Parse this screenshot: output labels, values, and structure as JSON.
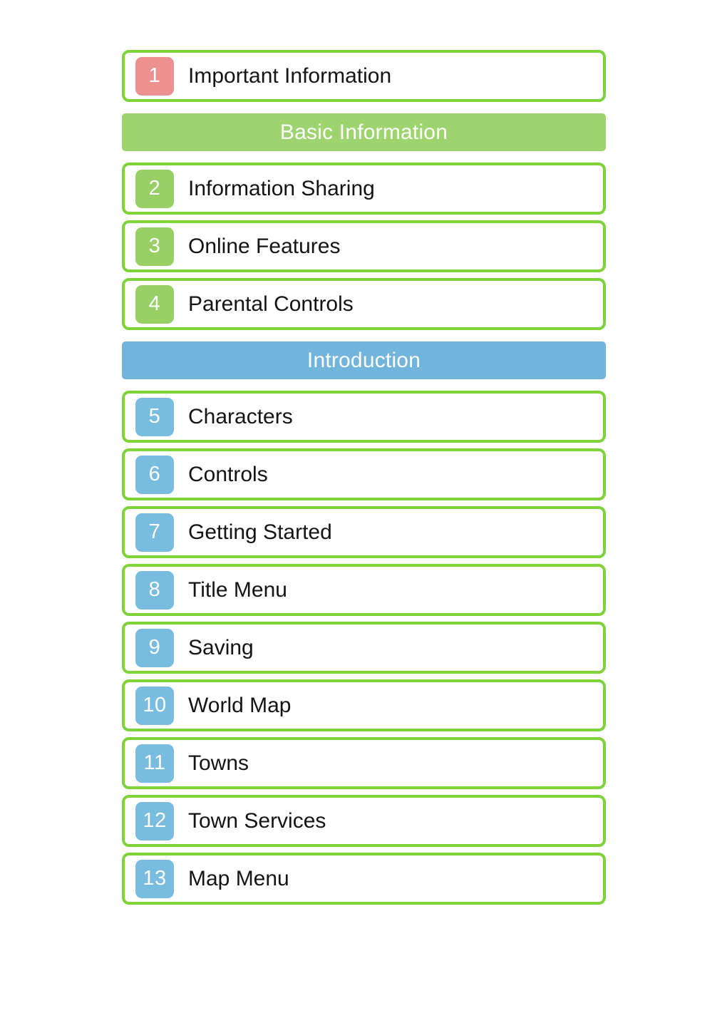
{
  "document": {
    "type": "electronic-manual-table-of-contents",
    "background_color": "#ffffff"
  },
  "colors": {
    "card_border_green": "#7ed338",
    "band_green": "#9ed46e",
    "band_blue": "#72b5dc",
    "badge_red": "#ec9090",
    "badge_green": "#98d065",
    "badge_blue": "#78bcdf",
    "label_text": "#141414",
    "band_text": "#ffffff"
  },
  "toc": {
    "blocks": [
      {
        "kind": "chapters",
        "items": [
          {
            "number": "1",
            "label": "Important Information",
            "badge_color": "red"
          }
        ]
      },
      {
        "kind": "section",
        "title": "Basic Information",
        "band_color": "green"
      },
      {
        "kind": "chapters",
        "items": [
          {
            "number": "2",
            "label": "Information Sharing",
            "badge_color": "green"
          },
          {
            "number": "3",
            "label": "Online Features",
            "badge_color": "green"
          },
          {
            "number": "4",
            "label": "Parental Controls",
            "badge_color": "green"
          }
        ]
      },
      {
        "kind": "section",
        "title": "Introduction",
        "band_color": "blue"
      },
      {
        "kind": "chapters",
        "items": [
          {
            "number": "5",
            "label": "Characters",
            "badge_color": "blue"
          },
          {
            "number": "6",
            "label": "Controls",
            "badge_color": "blue"
          },
          {
            "number": "7",
            "label": "Getting Started",
            "badge_color": "blue"
          },
          {
            "number": "8",
            "label": "Title Menu",
            "badge_color": "blue"
          },
          {
            "number": "9",
            "label": "Saving",
            "badge_color": "blue"
          },
          {
            "number": "10",
            "label": "World Map",
            "badge_color": "blue"
          },
          {
            "number": "11",
            "label": "Towns",
            "badge_color": "blue"
          },
          {
            "number": "12",
            "label": "Town Services",
            "badge_color": "blue"
          },
          {
            "number": "13",
            "label": "Map Menu",
            "badge_color": "blue"
          }
        ]
      }
    ]
  }
}
